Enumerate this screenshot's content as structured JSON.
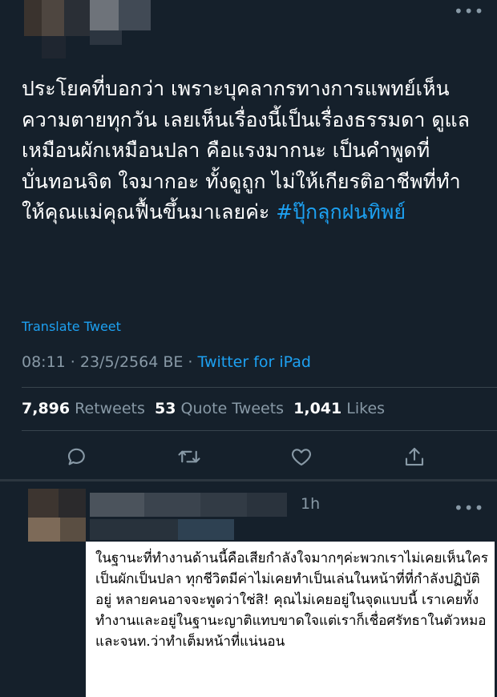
{
  "tweet": {
    "more_icon": "more-horizontal-icon",
    "text": "ประโยคที่บอกว่า เพราะบุคลากรทางการแพทย์เห็นความตายทุกวัน เลยเห็นเรื่องนี้เป็นเรื่องธรรมดา ดูแลเหมือนผักเหมือนปลา คือแรงมากนะ เป็นคำพูดที่บั่นทอนจิต ใจมากอะ ทั้งดูถูก ไม่ให้เกียรติอาชีพที่ทำ ให้คุณแม่คุณฟื้นขึ้นมาเลยค่ะ ",
    "hashtag": "#ปุ๊กลุกฝนทิพย์",
    "translate_label": "Translate Tweet",
    "timestamp": "08:11 · 23/5/2564 BE · ",
    "source": "Twitter for iPad",
    "stats": {
      "retweets_count": "7,896",
      "retweets_label": "Retweets",
      "quotes_count": "53",
      "quotes_label": "Quote Tweets",
      "likes_count": "1,041",
      "likes_label": "Likes"
    },
    "actions": [
      "reply-icon",
      "retweet-icon",
      "like-icon",
      "share-icon"
    ]
  },
  "reply": {
    "time": "1h",
    "text": "ในฐานะที่ทำงานด้านนี้คือเสียกำลังใจมากๆค่ะพวกเราไม่เคยเห็นใครเป็นผักเป็นปลา ทุกชีวิตมีค่าไม่เคยทำเป็นเล่นในหน้าที่ที่กำลังปฏิบัติอยู่ หลายคนอาจจะพูดว่าใช่สิ! คุณไม่เคยอยู่ในจุดแบบนี้ เราเคยทั้งทำงานและอยู่ในฐานะญาติแทบขาดใจแต่เราก็เชื่อศรัทธาในตัวหมอและจนท.ว่าทำเต็มหน้าที่แน่นอน"
  },
  "colors": {
    "background": "#15202b",
    "accent": "#1da1f2",
    "muted": "#8899a6",
    "divider": "#38444d"
  }
}
